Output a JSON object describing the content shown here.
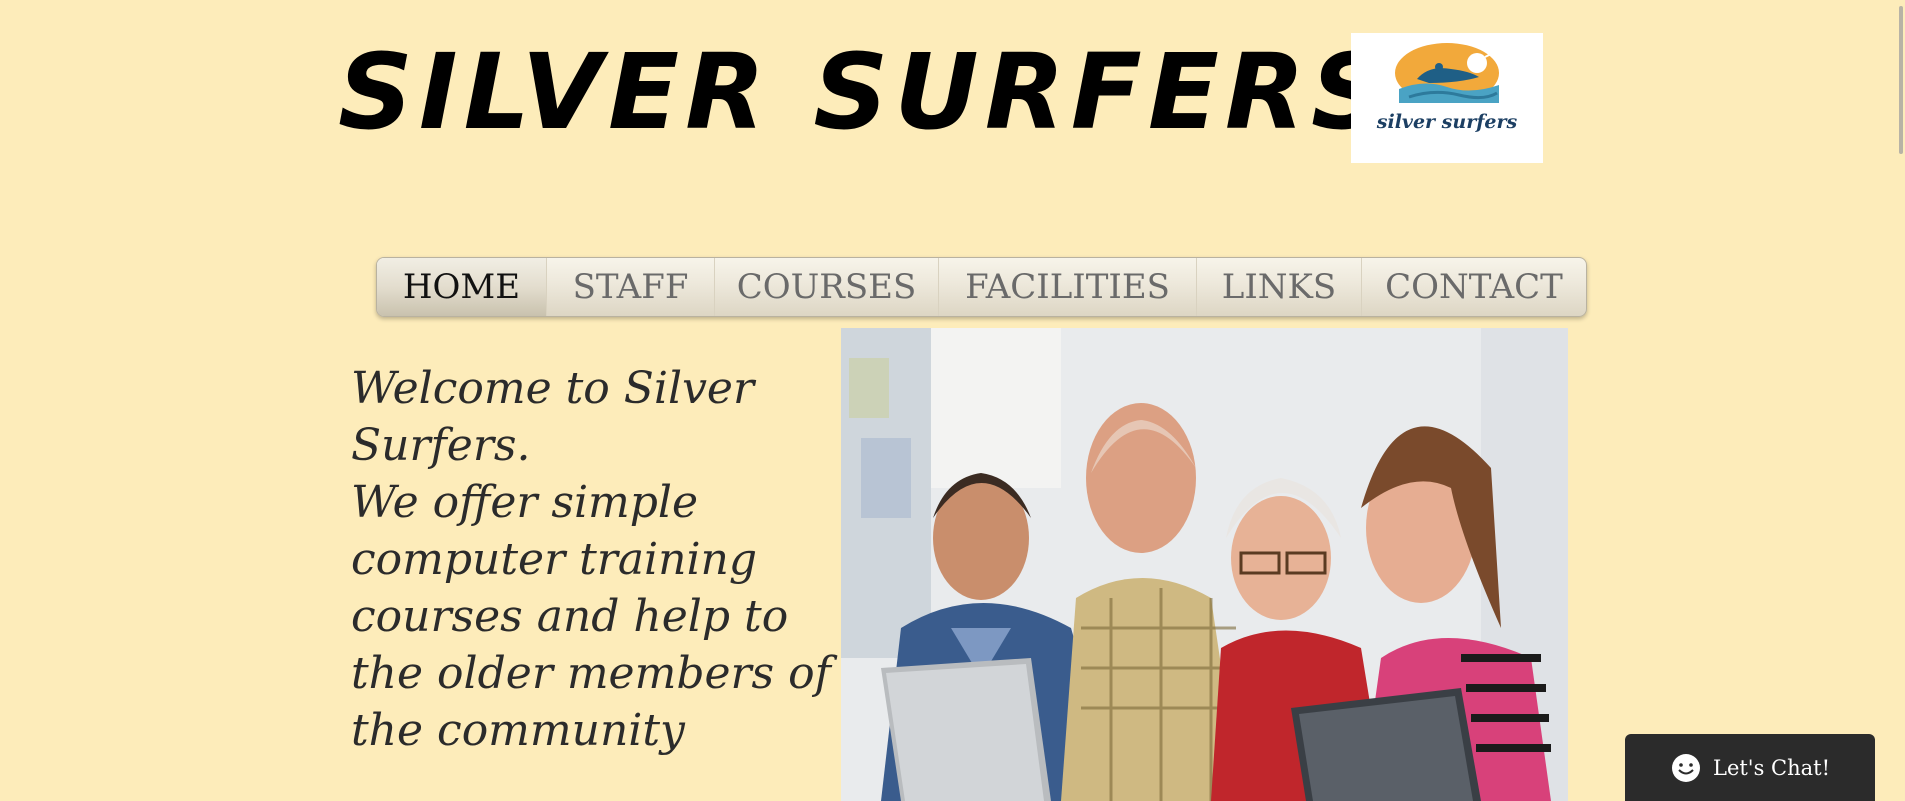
{
  "header": {
    "title": "SILVER SURFERS",
    "logo_text": "silver surfers"
  },
  "nav": {
    "items": [
      {
        "label": "HOME",
        "active": true
      },
      {
        "label": "STAFF",
        "active": false
      },
      {
        "label": "COURSES",
        "active": false
      },
      {
        "label": "FACILITIES",
        "active": false
      },
      {
        "label": "LINKS",
        "active": false
      },
      {
        "label": "CONTACT",
        "active": false
      }
    ]
  },
  "main": {
    "welcome_line1": "Welcome to Silver Surfers.",
    "welcome_line2": "We offer simple computer training courses and help to the older members of the community"
  },
  "hero_image": {
    "icon": "photo-seniors-laptops"
  },
  "chat": {
    "label": "Let's Chat!",
    "icon": "smile-icon"
  },
  "colors": {
    "background": "#fdecba",
    "chat_bg": "#2b2b2b",
    "logo_orange": "#f2a93b",
    "logo_blue": "#3a8fb0"
  }
}
